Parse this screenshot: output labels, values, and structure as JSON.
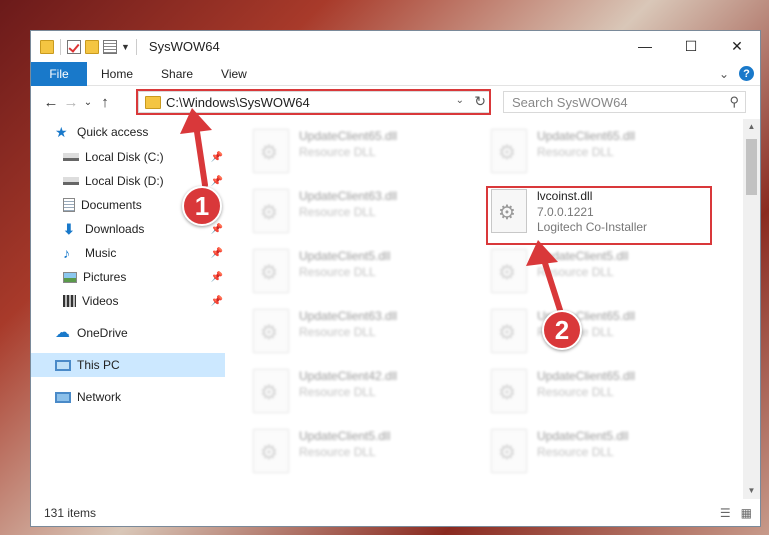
{
  "window": {
    "title": "SysWOW64",
    "min": "—",
    "max": "☐",
    "close": "✕"
  },
  "ribbon": {
    "file": "File",
    "tabs": [
      "Home",
      "Share",
      "View"
    ],
    "expand": "⌄",
    "help": "?"
  },
  "nav": {
    "back": "←",
    "forward": "→",
    "recent": "⌄",
    "up": "↑"
  },
  "address": {
    "path": "C:\\Windows\\SysWOW64",
    "chevron": "⌄",
    "refresh": "↻"
  },
  "search": {
    "placeholder": "Search SysWOW64",
    "icon": "⚲"
  },
  "sidebar": {
    "items": [
      {
        "label": "Quick access",
        "icon": "star-icon",
        "pinned": false
      },
      {
        "label": "Local Disk (C:)",
        "icon": "drive-icon",
        "pinned": true
      },
      {
        "label": "Local Disk (D:)",
        "icon": "drive-icon",
        "pinned": true
      },
      {
        "label": "Documents",
        "icon": "documents-icon",
        "pinned": false
      },
      {
        "label": "Downloads",
        "icon": "download-icon",
        "pinned": true
      },
      {
        "label": "Music",
        "icon": "music-icon",
        "pinned": true
      },
      {
        "label": "Pictures",
        "icon": "pictures-icon",
        "pinned": true
      },
      {
        "label": "Videos",
        "icon": "videos-icon",
        "pinned": true
      },
      {
        "label": "OneDrive",
        "icon": "cloud-icon",
        "pinned": false
      },
      {
        "label": "This PC",
        "icon": "pc-icon",
        "pinned": false
      },
      {
        "label": "Network",
        "icon": "network-icon",
        "pinned": false
      }
    ],
    "pin_glyph": "📌"
  },
  "files": [
    {
      "name": "UpdateClient65.dll",
      "desc": "Resource DLL"
    },
    {
      "name": "UpdateClient65.dll",
      "desc": "Resource DLL"
    },
    {
      "name": "UpdateClient63.dll",
      "desc": "Resource DLL"
    },
    {
      "name": "lvcoinst.dll",
      "version": "7.0.0.1221",
      "desc": "Logitech Co-Installer"
    },
    {
      "name": "UpdateClient5.dll",
      "desc": "Resource DLL"
    },
    {
      "name": "UpdateClient5.dll",
      "desc": "Resource DLL"
    },
    {
      "name": "UpdateClient63.dll",
      "desc": "Resource DLL"
    },
    {
      "name": "UpdateClient65.dll",
      "desc": "Resource DLL"
    },
    {
      "name": "UpdateClient42.dll",
      "desc": "Resource DLL"
    },
    {
      "name": "UpdateClient65.dll",
      "desc": "Resource DLL"
    },
    {
      "name": "UpdateClient5.dll",
      "desc": "Resource DLL"
    },
    {
      "name": "UpdateClient5.dll",
      "desc": "Resource DLL"
    }
  ],
  "status": {
    "count": "131 items",
    "details_view": "☰",
    "icons_view": "▦"
  },
  "callouts": [
    "1",
    "2"
  ],
  "colors": {
    "accent": "#1979ca",
    "highlight": "#d9383a",
    "selected": "#cce8ff"
  }
}
